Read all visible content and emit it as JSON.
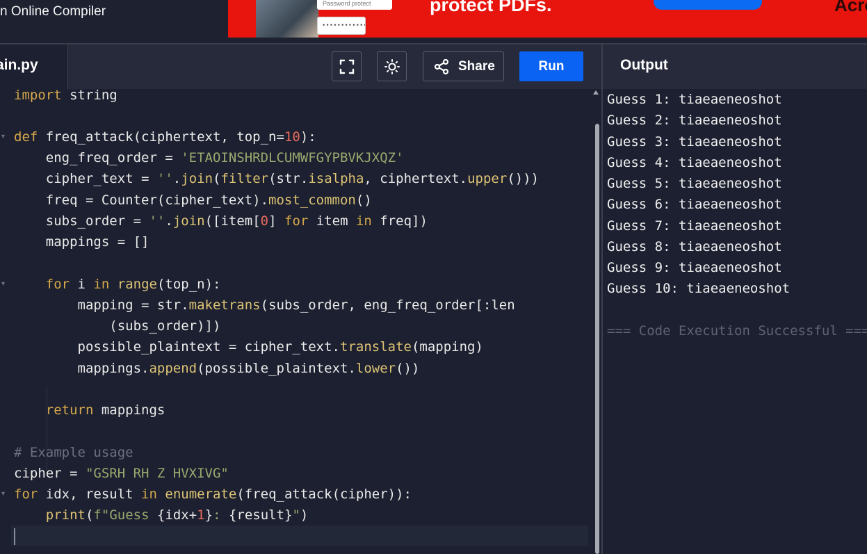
{
  "app": {
    "title": "n Online Compiler"
  },
  "ad": {
    "card_text": "Password protect",
    "password_mask": "••••••••••••••",
    "headline": "protect PDFs.",
    "brand": "Acro"
  },
  "editor": {
    "filename": "ain.py",
    "buttons": {
      "share_label": "Share",
      "run_label": "Run"
    },
    "code_lines": [
      "import string",
      "",
      "def freq_attack(ciphertext, top_n=10):",
      "    eng_freq_order = 'ETAOINSHRDLCUMWFGYPBVKJXQZ'",
      "    cipher_text = ''.join(filter(str.isalpha, ciphertext.upper()))",
      "    freq = Counter(cipher_text).most_common()",
      "    subs_order = ''.join([item[0] for item in freq])",
      "    mappings = []",
      "",
      "    for i in range(top_n):",
      "        mapping = str.maketrans(subs_order, eng_freq_order[:len",
      "            (subs_order)])",
      "        possible_plaintext = cipher_text.translate(mapping)",
      "        mappings.append(possible_plaintext.lower())",
      "",
      "    return mappings",
      "",
      "# Example usage",
      "cipher = \"GSRH RH Z HVXIVG\"",
      "for idx, result in enumerate(freq_attack(cipher)):",
      "    print(f\"Guess {idx+1}: {result}\")"
    ]
  },
  "output": {
    "title": "Output",
    "lines": [
      "Guess 1: tiaeaeneoshot",
      "Guess 2: tiaeaeneoshot",
      "Guess 3: tiaeaeneoshot",
      "Guess 4: tiaeaeneoshot",
      "Guess 5: tiaeaeneoshot",
      "Guess 6: tiaeaeneoshot",
      "Guess 7: tiaeaeneoshot",
      "Guess 8: tiaeaeneoshot",
      "Guess 9: tiaeaeneoshot",
      "Guess 10: tiaeaeneoshot"
    ],
    "status": "=== Code Execution Successful ==="
  }
}
